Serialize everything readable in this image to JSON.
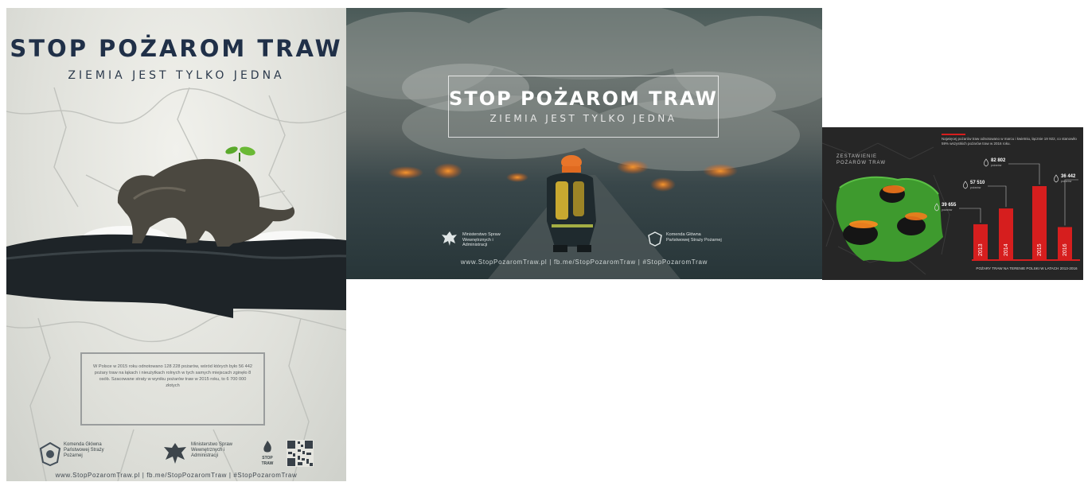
{
  "poster1": {
    "title": "STOP POŻAROM TRAW",
    "subtitle": "ZIEMIA JEST TYLKO JEDNA",
    "body_text": "W Polsce w 2015 roku odnotowano 128 228 pożarów, wśród których było 56 442 pożary traw na łąkach i nieużytkach rolnych w tych samych miejscach zginęło 8 osób. Szacowane straty w wyniku pożarów traw w 2015 roku, to 6 700 000 złotych",
    "logos": {
      "kg_psp": "Komenda Główna Państwowej Straży Pożarnej",
      "mswia": "Ministerstwo Spraw Wewnętrznych i Administracji",
      "stop": "STOP TRAW"
    },
    "footer": "www.StopPozaromTraw.pl | fb.me/StopPozaromTraw | #StopPozaromTraw"
  },
  "poster2": {
    "title": "STOP POŻAROM TRAW",
    "subtitle": "ZIEMIA JEST TYLKO JEDNA",
    "logo_left": "Ministerstwo Spraw Wewnętrznych i Administracji",
    "logo_right": "Komenda Główna Państwowej Straży Pożarnej",
    "footer": "www.StopPozaromTraw.pl | fb.me/StopPozaromTraw | #StopPozaromTraw"
  },
  "infographic": {
    "heading_line1": "ZESTAWIENIE",
    "heading_line2": "POŻARÓW TRAW",
    "description": "Najwięcej pożarów traw odnotowano w marcu i kwietniu, łącznie 19 922, co stanowiło 59% wszystkich pożarów traw w 2016 roku.",
    "caption": "POŻARY TRAW NA TERENIE POLSKI W LATACH 2013-2016",
    "colors": {
      "bar": "#d61e1e",
      "grass": "#3e9a2e",
      "background": "#262626"
    }
  },
  "chart_data": {
    "type": "bar",
    "title": "",
    "xlabel": "POŻARY TRAW NA TERENIE POLSKI W LATACH 2013-2016",
    "ylabel": "",
    "categories": [
      "2013",
      "2014",
      "2015",
      "2016"
    ],
    "values": [
      39655,
      57510,
      82802,
      36442
    ],
    "ylim": [
      0,
      90000
    ],
    "value_labels": [
      "39 655",
      "57 510",
      "82 802",
      "36 442"
    ],
    "value_notes": [
      "pożarów",
      "pożarów",
      "pożarów",
      "pożarów"
    ],
    "bar_color": "#d61e1e",
    "grid": false
  }
}
